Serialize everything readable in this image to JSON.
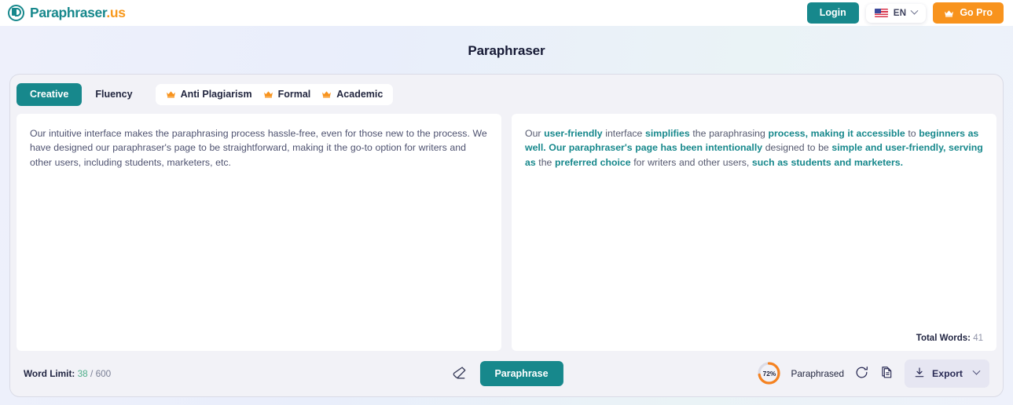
{
  "topbar": {
    "brand_name": "Paraphraser",
    "brand_tld": ".us",
    "login_label": "Login",
    "language_code": "EN",
    "gopro_label": "Go Pro"
  },
  "header": {
    "title": "Paraphraser"
  },
  "tabs": {
    "standard": [
      {
        "label": "Creative",
        "active": true
      },
      {
        "label": "Fluency",
        "active": false
      }
    ],
    "premium": [
      {
        "label": "Anti Plagiarism"
      },
      {
        "label": "Formal"
      },
      {
        "label": "Academic"
      }
    ]
  },
  "input_panel": {
    "text": "Our intuitive interface makes the paraphrasing process hassle-free, even for those new to the process. We have designed our paraphraser's page to be straightforward, making it the go-to option for writers and other users, including students, marketers, etc."
  },
  "output_panel": {
    "segments": [
      {
        "text": "Our ",
        "bold": false
      },
      {
        "text": "user-friendly",
        "bold": true
      },
      {
        "text": " interface ",
        "bold": false
      },
      {
        "text": "simplifies",
        "bold": true
      },
      {
        "text": " the paraphrasing ",
        "bold": false
      },
      {
        "text": "process, making it accessible",
        "bold": true
      },
      {
        "text": " to ",
        "bold": false
      },
      {
        "text": "beginners as well. Our paraphraser's page has been intentionally",
        "bold": true
      },
      {
        "text": " designed to be ",
        "bold": false
      },
      {
        "text": "simple and user-friendly, serving as",
        "bold": true
      },
      {
        "text": " the ",
        "bold": false
      },
      {
        "text": "preferred choice",
        "bold": true
      },
      {
        "text": " for writers and other users, ",
        "bold": false
      },
      {
        "text": "such as students and marketers.",
        "bold": true
      }
    ],
    "total_words_label": "Total Words:",
    "total_words_count": "41"
  },
  "toolbar": {
    "word_limit_label": "Word Limit:",
    "word_limit_used": "38",
    "word_limit_separator": "/",
    "word_limit_max": "600",
    "erase_icon": "eraser-icon",
    "paraphrase_label": "Paraphrase",
    "progress_percent": "72%",
    "progress_value": 72,
    "paraphrased_label": "Paraphrased",
    "refresh_icon": "refresh-icon",
    "copy_icon": "copy-icon",
    "export_label": "Export"
  },
  "colors": {
    "accent_teal": "#17888c",
    "accent_orange": "#f8931d",
    "progress_orange": "#f58220",
    "page_bg": "#eef0fb"
  }
}
